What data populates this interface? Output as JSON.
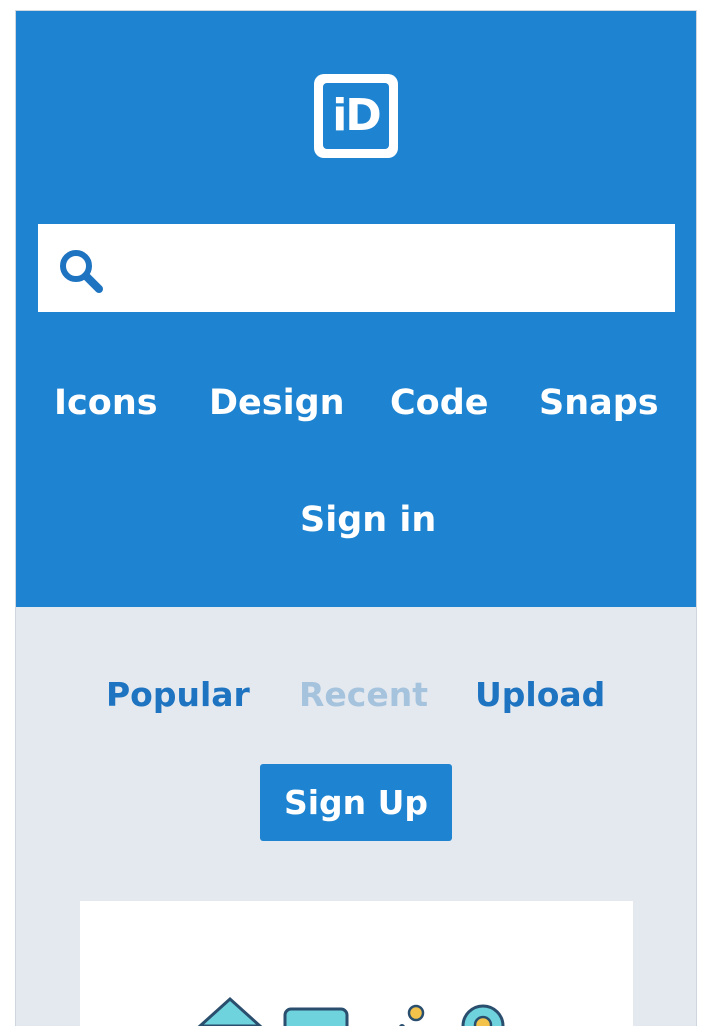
{
  "logo": {
    "text": "iD"
  },
  "search": {
    "placeholder": "",
    "value": ""
  },
  "nav": {
    "items": [
      "Icons",
      "Design",
      "Code",
      "Snaps"
    ],
    "signin": "Sign in"
  },
  "tabs": {
    "items": [
      "Popular",
      "Recent",
      "Upload"
    ],
    "active": "Recent"
  },
  "signup": {
    "label": "Sign Up"
  },
  "colors": {
    "brand": "#1e83d0",
    "link": "#1e74c0",
    "muted_link": "#a5c3dd",
    "page_bg": "#e4e9f0"
  },
  "card": {
    "icons": [
      "house-icon",
      "card-icon",
      "gear-icon",
      "location-pin-icon"
    ]
  }
}
